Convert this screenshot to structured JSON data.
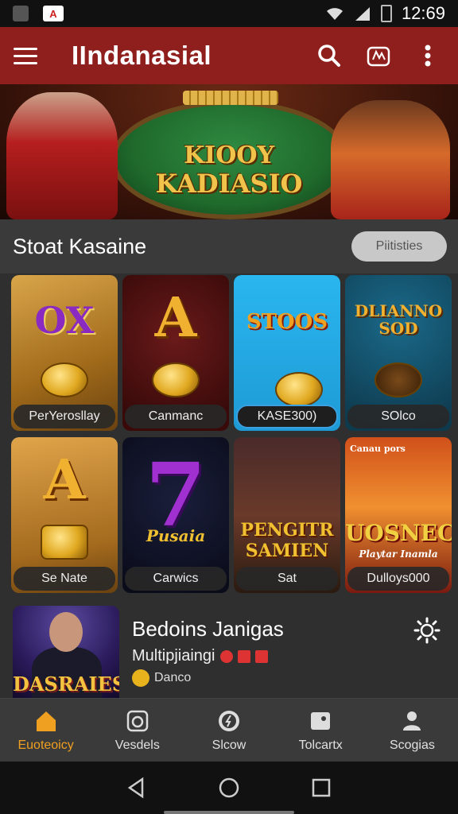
{
  "status_bar": {
    "time": "12:69"
  },
  "app_bar": {
    "title": "IIndanasial",
    "icons": [
      "menu-icon",
      "search-icon",
      "cart-icon",
      "more-vert-icon"
    ]
  },
  "banner": {
    "line1": "KIOOY",
    "line2": "KADIASIO"
  },
  "section": {
    "title": "Stoat Kasaine",
    "pill": "Piitisties"
  },
  "tiles": [
    {
      "logo": "OX",
      "label": "PerYerosllay",
      "logo_color": "#7a2aa0"
    },
    {
      "logo": "A",
      "label": "Canmanc",
      "logo_color": "#f0b030"
    },
    {
      "logo": "STOOS",
      "label": "KASE300)",
      "logo_color": "#f0a020"
    },
    {
      "logo": "DLIANNO SOD",
      "label": "SOlco",
      "logo_color": "#f0b030"
    },
    {
      "logo": "A",
      "label": "Se Nate",
      "logo_color": "#f0b030"
    },
    {
      "logo": "7",
      "label": "Carwics",
      "logo_color": "#b040e0"
    },
    {
      "logo": "PENGITR SAMIEN",
      "label": "Sat",
      "logo_color": "#f0c030"
    },
    {
      "logo": "UOSNEC",
      "label": "Dulloys000",
      "logo_color": "#f0d040"
    }
  ],
  "tile_extras": {
    "tile6_sub": "Pusaia",
    "tile8_top": "Canau pors",
    "tile8_sub": "Playtar Inamla"
  },
  "featured": {
    "thumb_logo": "DASRAIES",
    "title": "Bedoins Janigas",
    "subtitle": "Multipjiaingi",
    "meta": "Danco"
  },
  "bottom_nav": [
    {
      "label": "Euoteoicy",
      "icon": "home-icon",
      "active": true
    },
    {
      "label": "Vesdels",
      "icon": "camera-icon",
      "active": false
    },
    {
      "label": "Slcow",
      "icon": "compass-icon",
      "active": false
    },
    {
      "label": "Tolcartx",
      "icon": "photo-icon",
      "active": false
    },
    {
      "label": "Scogias",
      "icon": "person-icon",
      "active": false
    }
  ],
  "colors": {
    "app_bar": "#8f1f1c",
    "accent": "#f0a020",
    "background": "#2f2f2f"
  }
}
